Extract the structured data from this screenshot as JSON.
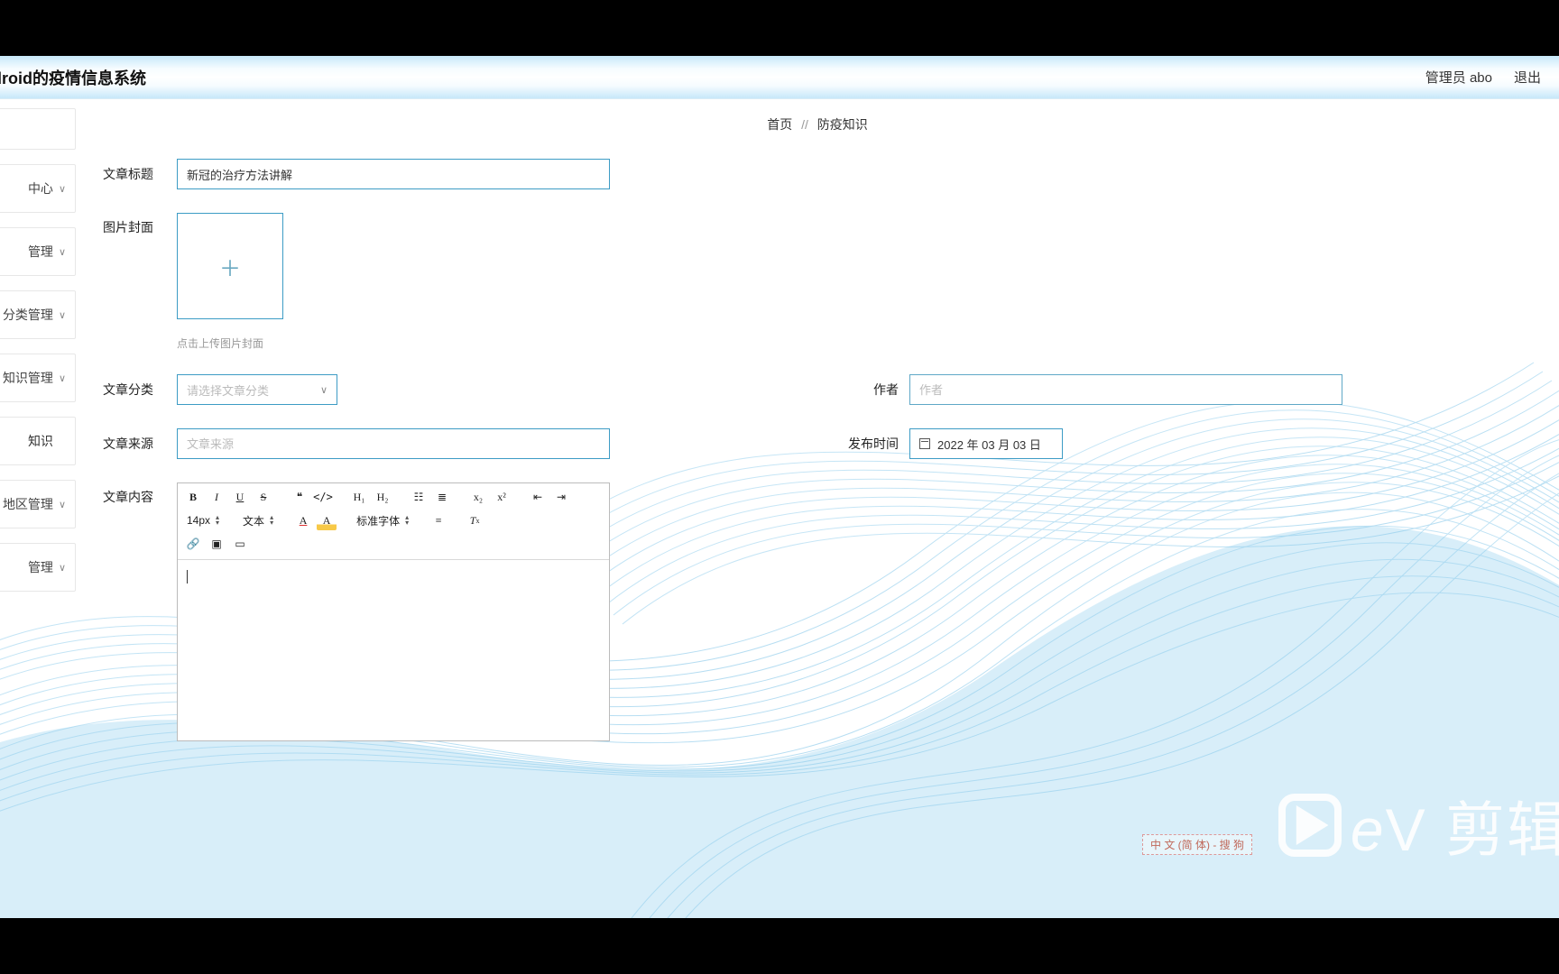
{
  "header": {
    "title": "ndroid的疫情信息系统",
    "admin_label": "管理员 abo",
    "logout": "退出"
  },
  "breadcrumb": {
    "home": "首页",
    "sep": "//",
    "current": "防疫知识"
  },
  "sidebar": {
    "items": [
      {
        "label": "",
        "blank": true
      },
      {
        "label": "中心",
        "arrow": true
      },
      {
        "label": "管理",
        "arrow": true
      },
      {
        "label": "分类管理",
        "arrow": true
      },
      {
        "label": "知识管理",
        "arrow": true
      },
      {
        "label": "知识",
        "arrow": false
      },
      {
        "label": "地区管理",
        "arrow": true
      },
      {
        "label": "管理",
        "arrow": true
      }
    ]
  },
  "form": {
    "title_label": "文章标题",
    "title_value": "新冠的治疗方法讲解",
    "cover_label": "图片封面",
    "cover_hint": "点击上传图片封面",
    "category_label": "文章分类",
    "category_placeholder": "请选择文章分类",
    "author_label": "作者",
    "author_placeholder": "作者",
    "source_label": "文章来源",
    "source_placeholder": "文章来源",
    "publish_label": "发布时间",
    "publish_value": "2022 年 03 月 03 日",
    "content_label": "文章内容"
  },
  "editor_toolbar": {
    "font_size": "14px",
    "text_type": "文本",
    "font_family": "标准字体"
  },
  "ime": "中 文 (简 体) - 搜 狗",
  "watermark": "剪辑"
}
